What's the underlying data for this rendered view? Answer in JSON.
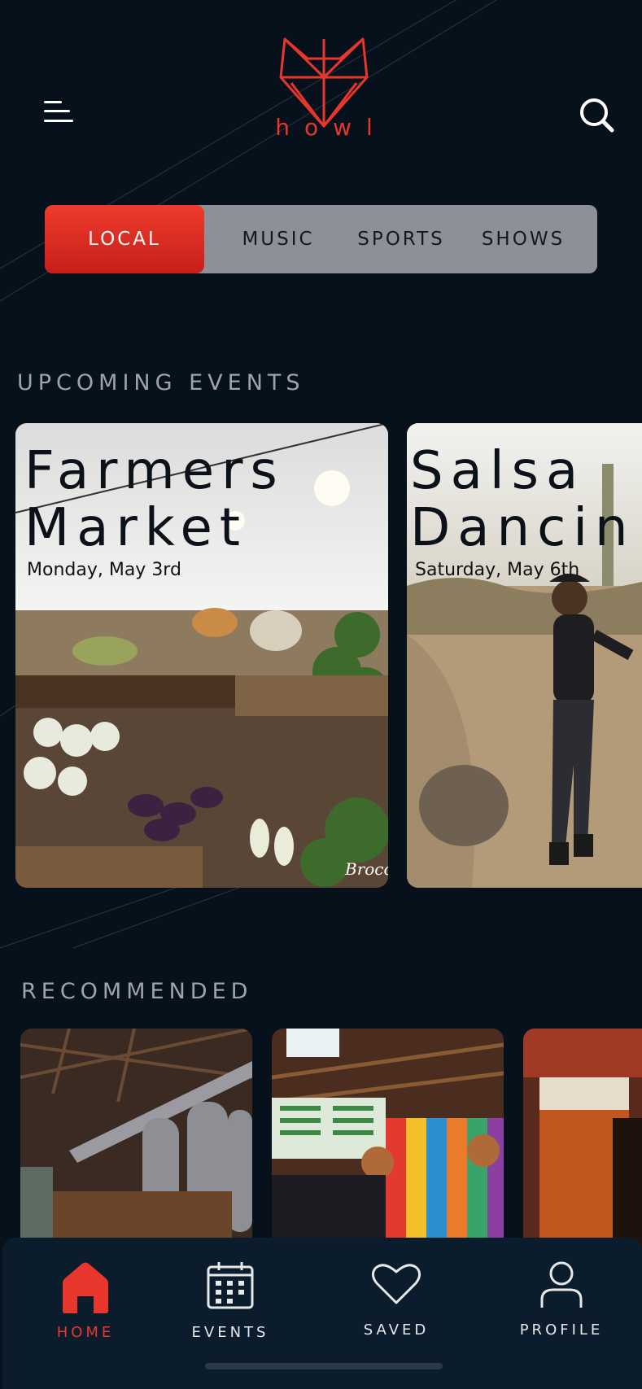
{
  "app": {
    "logo_text": "howl",
    "brand_color": "#e8362c",
    "background": "#06111c"
  },
  "header": {
    "menu_icon": "hamburger-menu-icon",
    "search_icon": "search-icon",
    "logo_icon": "fox-head-logo-icon"
  },
  "tabs": [
    {
      "label": "LOCAL",
      "active": true
    },
    {
      "label": "MUSIC",
      "active": false
    },
    {
      "label": "SPORTS",
      "active": false
    },
    {
      "label": "SHOWS",
      "active": false
    }
  ],
  "upcoming": {
    "title": "UPCOMING EVENTS",
    "events": [
      {
        "title": "Farmers\nMarket",
        "date": "Monday, May 3rd",
        "image": "farmers-market-produce-photo"
      },
      {
        "title": "Salsa\nDancin",
        "date": "Saturday, May 6th",
        "image": "desert-dancing-photo"
      }
    ]
  },
  "recommended": {
    "title": "RECOMMENDED",
    "items": [
      {
        "image": "brewery-tanks-photo"
      },
      {
        "image": "taproom-bar-photo"
      },
      {
        "image": "beer-glasses-photo"
      }
    ]
  },
  "bottom_nav": [
    {
      "label": "HOME",
      "icon": "home-icon",
      "active": true
    },
    {
      "label": "EVENTS",
      "icon": "calendar-icon",
      "active": false
    },
    {
      "label": "SAVED",
      "icon": "heart-icon",
      "active": false
    },
    {
      "label": "PROFILE",
      "icon": "user-icon",
      "active": false
    }
  ]
}
